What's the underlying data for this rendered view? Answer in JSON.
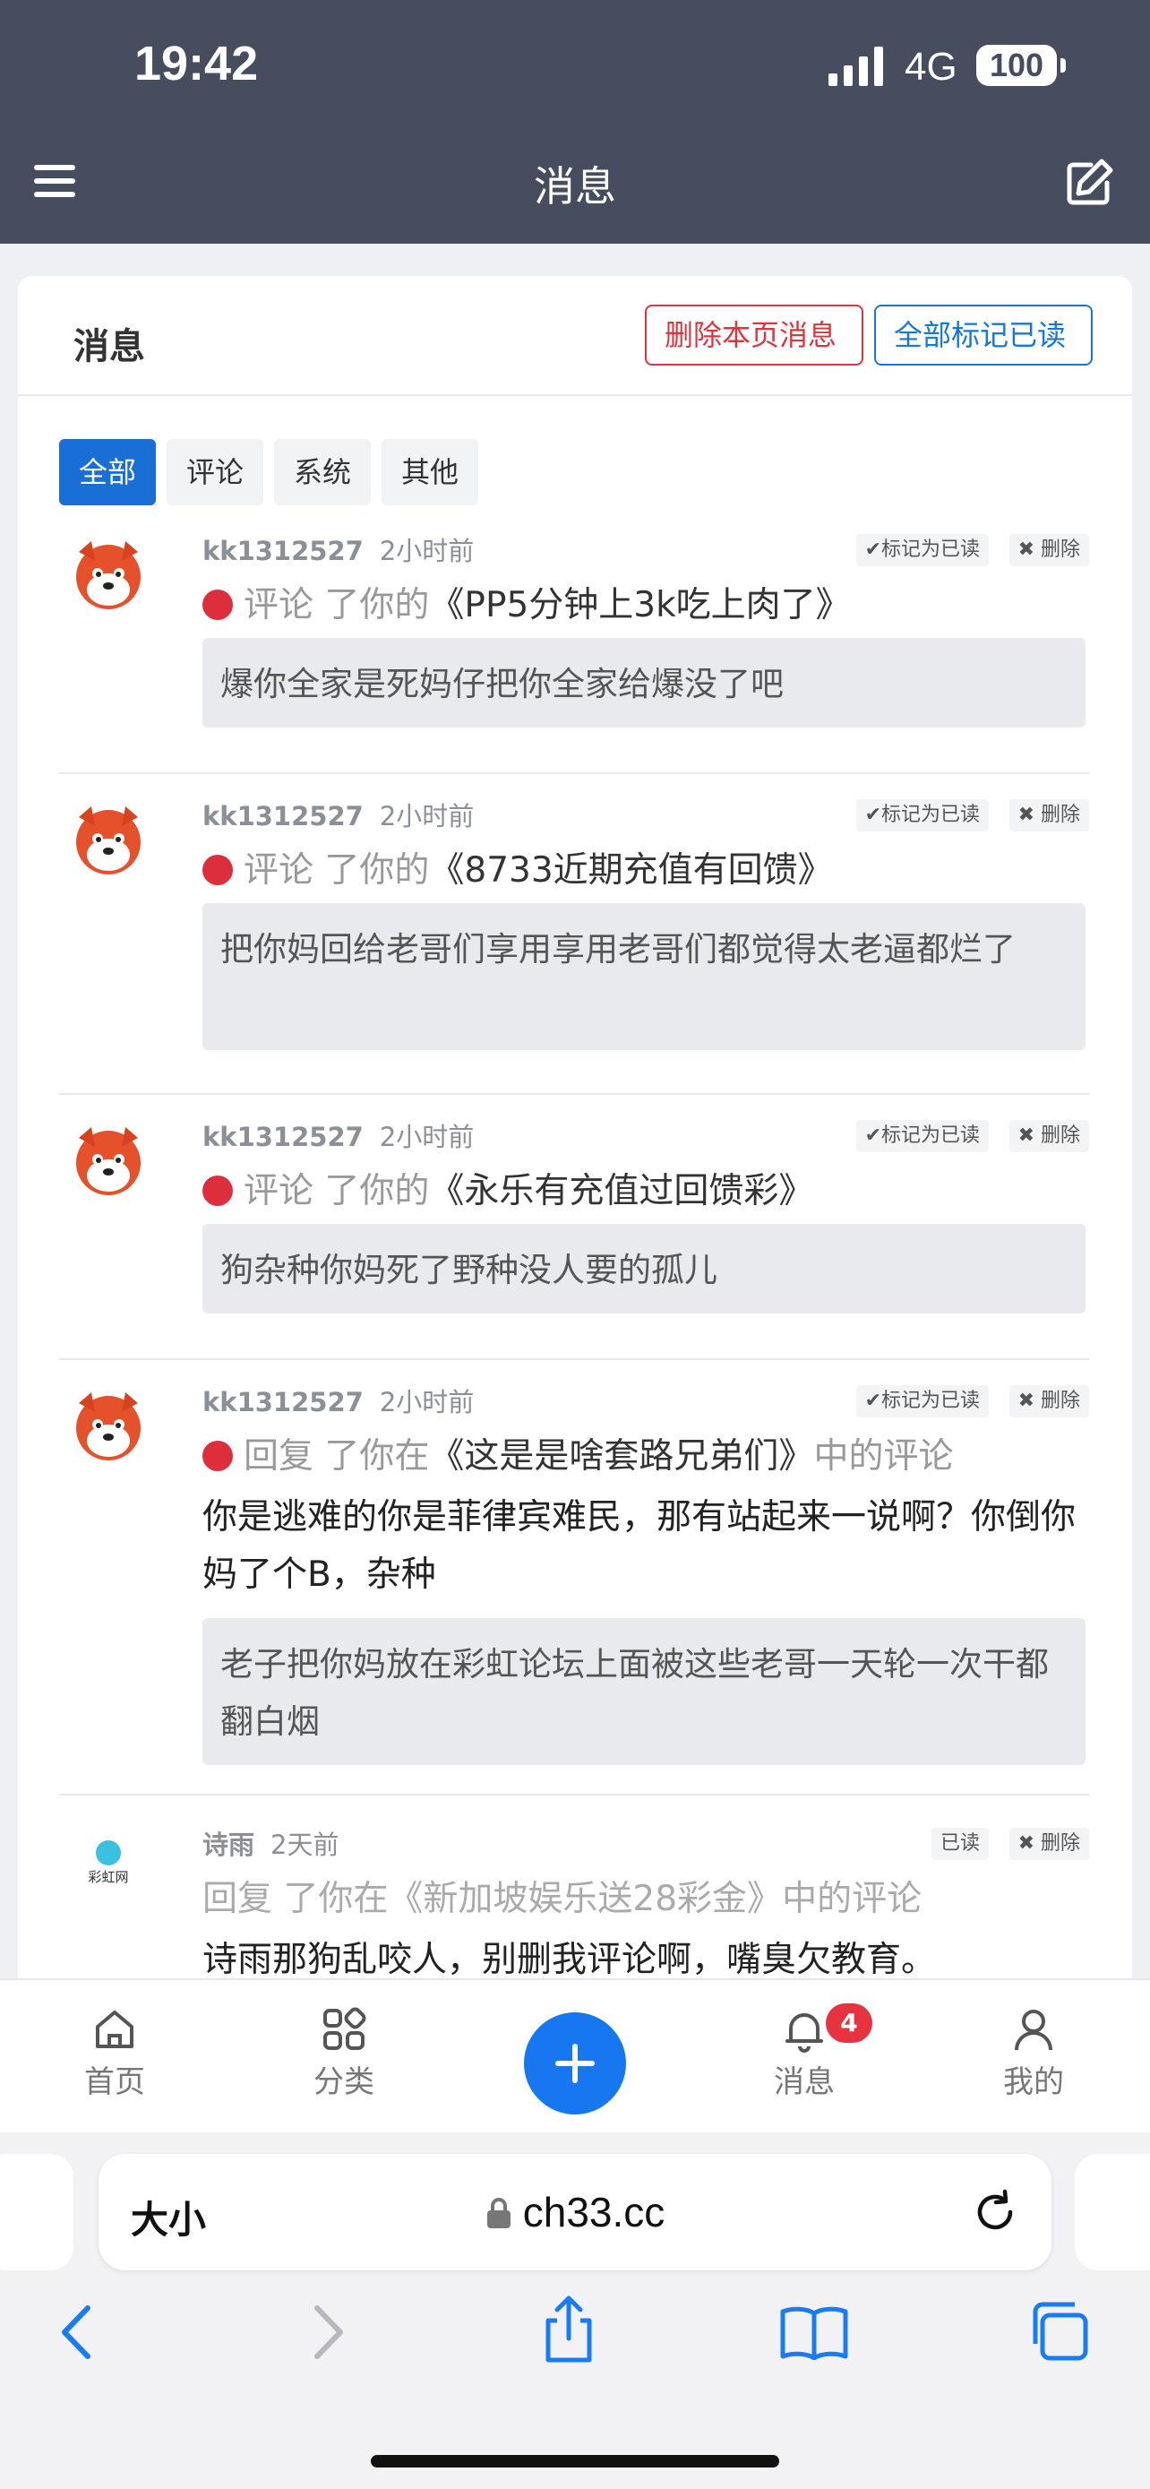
{
  "status_bar": {
    "time": "19:42",
    "network": "4G",
    "battery": "100"
  },
  "header": {
    "title": "消息"
  },
  "card": {
    "title": "消息",
    "delete_page_label": "删除本页消息",
    "mark_all_read_label": "全部标记已读",
    "tabs": [
      {
        "label": "全部",
        "active": true
      },
      {
        "label": "评论",
        "active": false
      },
      {
        "label": "系统",
        "active": false
      },
      {
        "label": "其他",
        "active": false
      }
    ]
  },
  "messages": [
    {
      "user": "kk1312527",
      "time": "2小时前",
      "read_label": "✔标记为已读",
      "delete_label": "✖ 删除",
      "action": "评论",
      "verb": " 了你的",
      "title": "《PP5分钟上3k吃上肉了》",
      "suffix": "",
      "body": "",
      "quote": "爆你全家是死妈仔把你全家给爆没了吧"
    },
    {
      "user": "kk1312527",
      "time": "2小时前",
      "read_label": "✔标记为已读",
      "delete_label": "✖ 删除",
      "action": "评论",
      "verb": " 了你的",
      "title": "《8733近期充值有回馈》",
      "suffix": "",
      "body": "",
      "quote": "把你妈回给老哥们享用享用老哥们都觉得太老逼都烂了"
    },
    {
      "user": "kk1312527",
      "time": "2小时前",
      "read_label": "✔标记为已读",
      "delete_label": "✖ 删除",
      "action": "评论",
      "verb": " 了你的",
      "title": "《永乐有充值过回馈彩》",
      "suffix": "",
      "body": "",
      "quote": "狗杂种你妈死了野种没人要的孤儿"
    },
    {
      "user": "kk1312527",
      "time": "2小时前",
      "read_label": "✔标记为已读",
      "delete_label": "✖ 删除",
      "action": "回复",
      "verb": " 了你在",
      "title": "《这是是啥套路兄弟们》",
      "suffix": "中的评论",
      "body": "你是逃难的你是菲律宾难民，那有站起来一说啊？你倒你妈了个B，杂种",
      "quote": "老子把你妈放在彩虹论坛上面被这些老哥一天轮一次干都翻白烟"
    },
    {
      "user": "诗雨",
      "time": "2天前",
      "read_label": "已读",
      "delete_label": "✖ 删除",
      "action": "回复",
      "verb": " 了你在",
      "title": "《新加坡娱乐送28彩金》",
      "suffix": "中的评论",
      "body": "诗雨那狗乱咬人，别删我评论啊，嘴臭欠教育。",
      "quote": ""
    }
  ],
  "avatar_logo_text": "彩虹网",
  "tabbar": {
    "home": "首页",
    "category": "分类",
    "messages": "消息",
    "messages_badge": "4",
    "me": "我的"
  },
  "browser": {
    "text_size": "大小",
    "url": "ch33.cc"
  },
  "colors": {
    "header_bg": "#454d5e",
    "accent": "#1677d8",
    "danger": "#d9363e"
  }
}
